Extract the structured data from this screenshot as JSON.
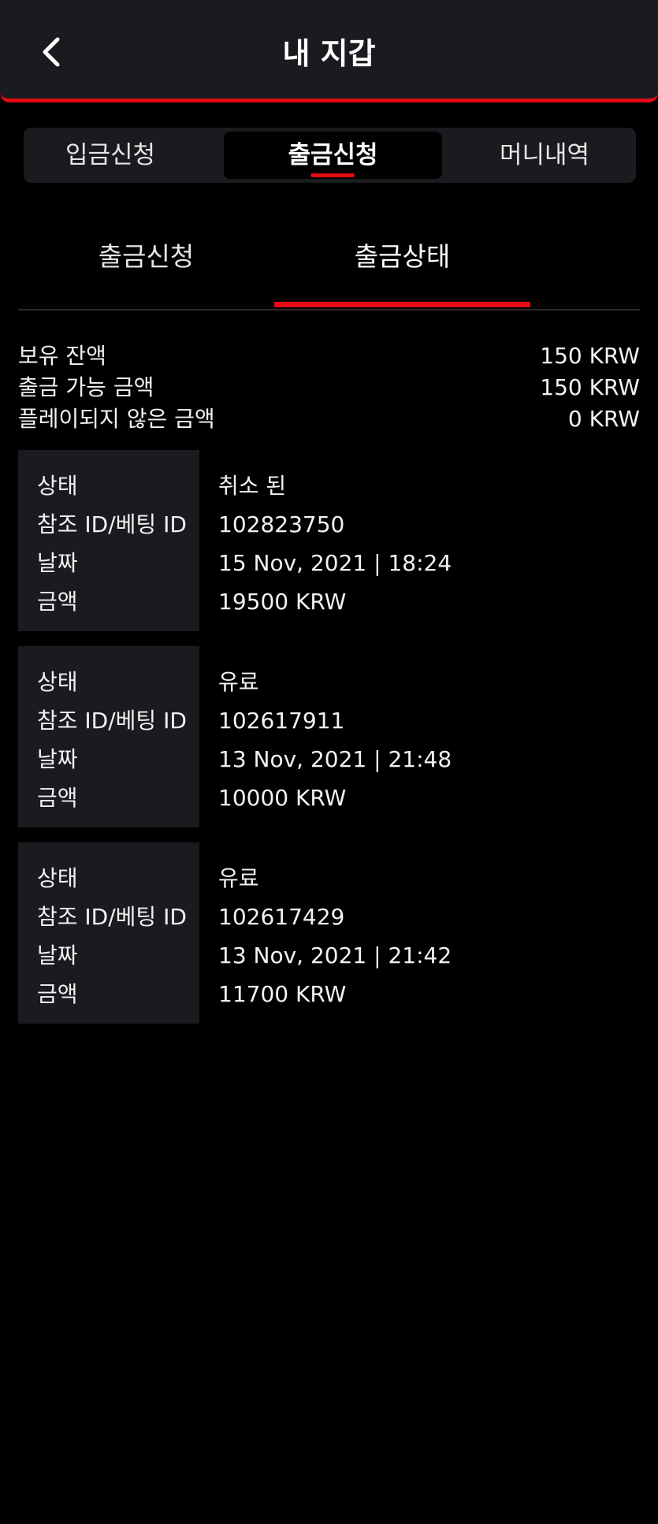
{
  "header": {
    "title": "내 지갑",
    "back_icon": "chevron-left-icon"
  },
  "top_tabs": [
    {
      "label": "입금신청"
    },
    {
      "label": "출금신청",
      "active": true
    },
    {
      "label": "머니내역"
    }
  ],
  "sub_tabs": [
    {
      "label": "출금신청"
    },
    {
      "label": "출금상태",
      "active": true
    }
  ],
  "balances": [
    {
      "label": "보유 잔액",
      "value": "150 KRW"
    },
    {
      "label": "출금 가능 금액",
      "value": "150 KRW"
    },
    {
      "label": "플레이되지 않은 금액",
      "value": "0 KRW"
    }
  ],
  "record_labels": {
    "status": "상태",
    "reference": "참조 ID/베팅 ID",
    "date": "날짜",
    "amount": "금액"
  },
  "records": [
    {
      "status": "취소 된",
      "reference": "102823750",
      "date": "15 Nov, 2021 | 18:24",
      "amount": "19500 KRW"
    },
    {
      "status": "유료",
      "reference": "102617911",
      "date": "13 Nov, 2021 | 21:48",
      "amount": "10000 KRW"
    },
    {
      "status": "유료",
      "reference": "102617429",
      "date": "13 Nov, 2021 | 21:42",
      "amount": "11700 KRW"
    }
  ],
  "colors": {
    "accent": "#e50914",
    "surface": "#1a1b1f",
    "background": "#000000",
    "text": "#ffffff"
  }
}
